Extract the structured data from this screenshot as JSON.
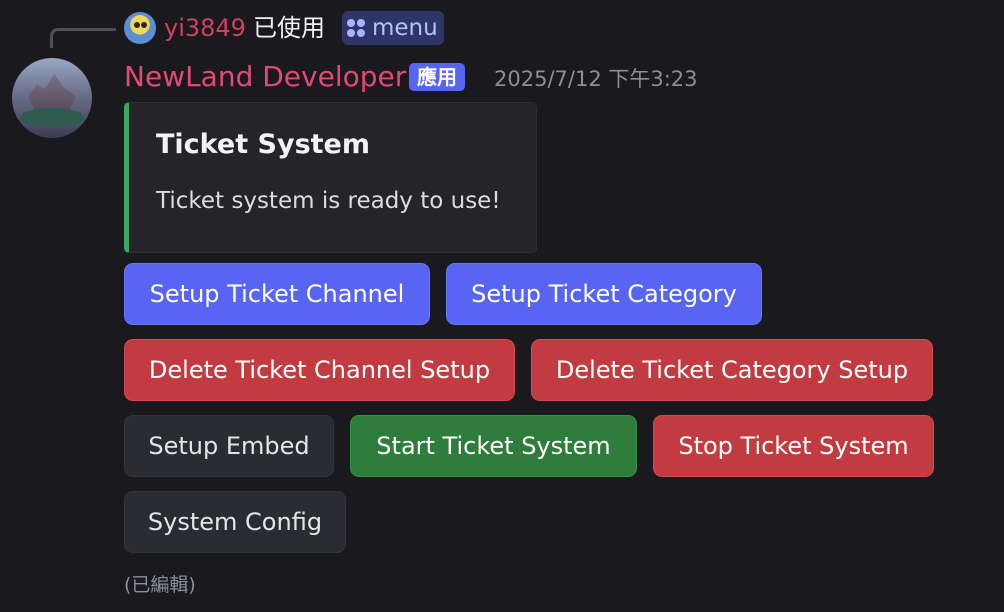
{
  "reply": {
    "username": "yi3849",
    "used_text": "已使用",
    "command": "menu",
    "avatar_icon": "spongebob-avatar-icon",
    "command_icon": "slash-command-icon"
  },
  "message": {
    "author": "NewLand Developer",
    "app_badge": "應用",
    "timestamp": "2025/7/12 下午3:23",
    "author_color": "#e04a73",
    "edited_label": "(已編輯)"
  },
  "embed": {
    "title": "Ticket System",
    "description": "Ticket system is ready to use!",
    "accent_color": "#3ba55d"
  },
  "buttons": {
    "setup_channel": "Setup Ticket Channel",
    "setup_category": "Setup Ticket Category",
    "delete_channel": "Delete Ticket Channel Setup",
    "delete_category": "Delete Ticket Category Setup",
    "setup_embed": "Setup Embed",
    "start_system": "Start Ticket System",
    "stop_system": "Stop Ticket System",
    "system_config": "System Config"
  },
  "colors": {
    "primary": "#5865f2",
    "danger": "#c23b41",
    "success": "#2f7d3c",
    "secondary": "#2b2c31",
    "background": "#1a1a1e"
  }
}
